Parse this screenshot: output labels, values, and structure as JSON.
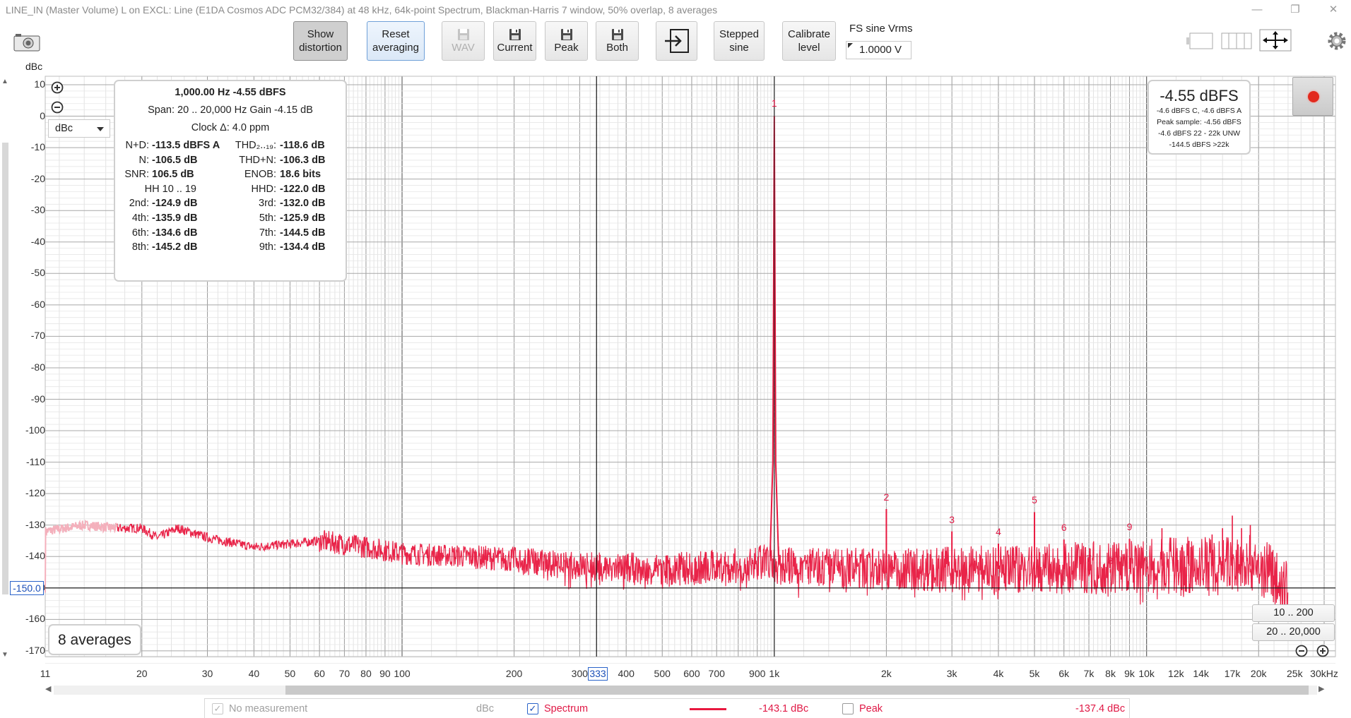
{
  "window": {
    "title": "LINE_IN (Master Volume) L on EXCL: Line (E1DA Cosmos ADC PCM32/384) at 48 kHz, 64k-point Spectrum, Blackman-Harris 7 window, 50% overlap, 8 averages",
    "minimize": "—",
    "restore": "❐",
    "close": "✕"
  },
  "toolbar": {
    "show_distortion_1": "Show",
    "show_distortion_2": "distortion",
    "reset_averaging_1": "Reset",
    "reset_averaging_2": "averaging",
    "wav": "WAV",
    "current": "Current",
    "peak": "Peak",
    "both": "Both",
    "stepped_sine_1": "Stepped",
    "stepped_sine_2": "sine",
    "calibrate_level_1": "Calibrate",
    "calibrate_level_2": "level",
    "fs_label": "FS sine Vrms",
    "fs_value": "1.0000 V"
  },
  "graph": {
    "y_unit": "dBc",
    "unit_select": "dBc",
    "y_cursor": "-150.0",
    "x_cursor": "333",
    "averages_label": "8 averages",
    "zoom_buttons": [
      "10 .. 200",
      "20 .. 20,000"
    ]
  },
  "stats": {
    "header": "1,000.00 Hz  -4.55 dBFS",
    "span": "Span: 20 .. 20,000 Hz   Gain -4.15 dB",
    "clock": "Clock Δ: 4.0 ppm",
    "hh": "HH 10 .. 19",
    "left_rows": [
      {
        "label": "N+D:",
        "value": "-113.5 dBFS A"
      },
      {
        "label": "N:",
        "value": "-106.5 dB"
      },
      {
        "label": "SNR:",
        "value": "106.5 dB"
      },
      {
        "label": "2nd:",
        "value": "-124.9 dB"
      },
      {
        "label": "4th:",
        "value": "-135.9 dB"
      },
      {
        "label": "6th:",
        "value": "-134.6 dB"
      },
      {
        "label": "8th:",
        "value": "-145.2 dB"
      }
    ],
    "right_rows": [
      {
        "label": "THD₂..₁₉:",
        "value": "-118.6 dB"
      },
      {
        "label": "THD+N:",
        "value": "-106.3 dB"
      },
      {
        "label": "ENOB:",
        "value": "18.6 bits"
      },
      {
        "label": "HHD:",
        "value": "-122.0 dB"
      },
      {
        "label": "3rd:",
        "value": "-132.0 dB"
      },
      {
        "label": "5th:",
        "value": "-125.9 dB"
      },
      {
        "label": "7th:",
        "value": "-144.5 dB"
      },
      {
        "label": "9th:",
        "value": "-134.4 dB"
      }
    ]
  },
  "level_meter": {
    "main": "-4.55 dBFS",
    "line1": "-4.6 dBFS C, -4.6 dBFS A",
    "line2": "Peak sample: -4.56 dBFS",
    "line3": "-4.6 dBFS 22 - 22k UNW",
    "line4": "-144.5 dBFS >22k"
  },
  "legend": {
    "no_measurement": "No measurement",
    "no_measurement_unit": "dBc",
    "spectrum": "Spectrum",
    "spectrum_value": "-143.1 dBc",
    "peak": "Peak",
    "peak_value": "-137.4 dBc",
    "spectrum_color": "#e8183f"
  },
  "chart_data": {
    "type": "line",
    "ylabel": "dBc",
    "xscale": "log",
    "x_unit_label": "kHz",
    "xlim": [
      11,
      30000
    ],
    "ylim": [
      -175,
      10
    ],
    "y_ticks": [
      10,
      0,
      -10,
      -20,
      -30,
      -40,
      -50,
      -60,
      -70,
      -80,
      -90,
      -100,
      -110,
      -120,
      -130,
      -140,
      -150,
      -160,
      -170
    ],
    "x_ticks": [
      {
        "v": 11,
        "label": "11"
      },
      {
        "v": 20,
        "label": "20"
      },
      {
        "v": 30,
        "label": "30"
      },
      {
        "v": 40,
        "label": "40"
      },
      {
        "v": 50,
        "label": "50"
      },
      {
        "v": 60,
        "label": "60"
      },
      {
        "v": 70,
        "label": "70"
      },
      {
        "v": 80,
        "label": "80"
      },
      {
        "v": 90,
        "label": "90"
      },
      {
        "v": 100,
        "label": "100"
      },
      {
        "v": 200,
        "label": "200"
      },
      {
        "v": 300,
        "label": "300"
      },
      {
        "v": 400,
        "label": "400"
      },
      {
        "v": 500,
        "label": "500"
      },
      {
        "v": 600,
        "label": "600"
      },
      {
        "v": 700,
        "label": "700"
      },
      {
        "v": 900,
        "label": "900"
      },
      {
        "v": 1000,
        "label": "1k"
      },
      {
        "v": 2000,
        "label": "2k"
      },
      {
        "v": 3000,
        "label": "3k"
      },
      {
        "v": 4000,
        "label": "4k"
      },
      {
        "v": 5000,
        "label": "5k"
      },
      {
        "v": 6000,
        "label": "6k"
      },
      {
        "v": 7000,
        "label": "7k"
      },
      {
        "v": 8000,
        "label": "8k"
      },
      {
        "v": 9000,
        "label": "9k"
      },
      {
        "v": 10000,
        "label": "10k"
      },
      {
        "v": 12000,
        "label": "12k"
      },
      {
        "v": 14000,
        "label": "14k"
      },
      {
        "v": 17000,
        "label": "17k"
      },
      {
        "v": 20000,
        "label": "20k"
      },
      {
        "v": 25000,
        "label": "25k"
      },
      {
        "v": 30000,
        "label": "30kHz"
      }
    ],
    "cursor": {
      "x": 333,
      "y": -150
    },
    "fundamental": {
      "freq": 1000,
      "level": 0
    },
    "harmonics": [
      {
        "n": "1",
        "freq": 1000,
        "level": 0
      },
      {
        "n": "2",
        "freq": 2000,
        "level": -124.9
      },
      {
        "n": "3",
        "freq": 3000,
        "level": -132.0
      },
      {
        "n": "4",
        "freq": 4000,
        "level": -135.9
      },
      {
        "n": "5",
        "freq": 5000,
        "level": -125.9
      },
      {
        "n": "6",
        "freq": 6000,
        "level": -134.6
      },
      {
        "n": "7",
        "freq": 7000,
        "level": -144.5
      },
      {
        "n": "8",
        "freq": 8000,
        "level": -145.2
      },
      {
        "n": "9",
        "freq": 9000,
        "level": -134.4
      }
    ],
    "spurs": [
      {
        "freq": 11000,
        "level": -131
      },
      {
        "freq": 13000,
        "level": -135
      },
      {
        "freq": 15000,
        "level": -133
      },
      {
        "freq": 16000,
        "level": -131
      },
      {
        "freq": 17000,
        "level": -127
      },
      {
        "freq": 18000,
        "level": -131
      },
      {
        "freq": 19000,
        "level": -130
      }
    ],
    "series": [
      {
        "name": "Spectrum",
        "color": "#e8183f",
        "floor": [
          [
            11,
            -132
          ],
          [
            14,
            -130
          ],
          [
            17,
            -131
          ],
          [
            20,
            -131
          ],
          [
            22,
            -134
          ],
          [
            25,
            -131
          ],
          [
            30,
            -134
          ],
          [
            40,
            -137
          ],
          [
            50,
            -136
          ],
          [
            60,
            -135
          ],
          [
            80,
            -137
          ],
          [
            100,
            -139
          ],
          [
            150,
            -140
          ],
          [
            200,
            -141
          ],
          [
            300,
            -143
          ],
          [
            500,
            -144
          ],
          [
            800,
            -143
          ],
          [
            950,
            -142
          ],
          [
            1050,
            -143
          ],
          [
            2000,
            -144
          ],
          [
            5000,
            -144
          ],
          [
            10000,
            -143
          ],
          [
            20000,
            -142
          ],
          [
            24000,
            -150
          ]
        ]
      }
    ]
  }
}
